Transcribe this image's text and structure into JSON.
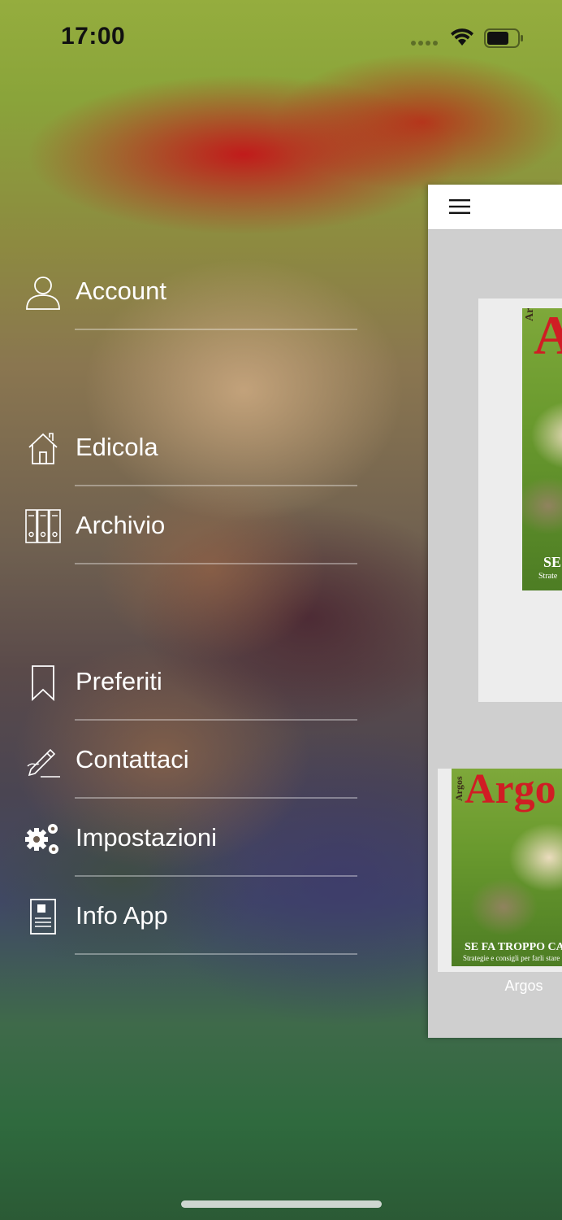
{
  "status_bar": {
    "time": "17:00",
    "icons": [
      "cellular-signal-icon",
      "wifi-icon",
      "battery-icon"
    ]
  },
  "menu": {
    "items": [
      {
        "label": "Account",
        "icon": "user-icon"
      },
      {
        "label": "Edicola",
        "icon": "home-icon"
      },
      {
        "label": "Archivio",
        "icon": "archive-binders-icon"
      },
      {
        "label": "Preferiti",
        "icon": "bookmark-icon"
      },
      {
        "label": "Contattaci",
        "icon": "signature-pen-icon"
      },
      {
        "label": "Impostazioni",
        "icon": "gears-icon"
      },
      {
        "label": "Info App",
        "icon": "document-info-icon"
      }
    ]
  },
  "content_panel": {
    "nav_icon": "hamburger-menu-icon",
    "featured_cover": {
      "brand": "Argos",
      "masthead": "A",
      "headline": "SE",
      "subline": "Strate"
    },
    "thumbnail": {
      "brand": "Argos",
      "masthead": "Argo",
      "headline": "SE FA TROPPO CA",
      "subline": "Strategie e consigli per farli stare"
    },
    "thumbnail_caption": "Argos"
  },
  "colors": {
    "menu_text": "#ffffff",
    "masthead_red": "#d01d24",
    "panel_background": "#cfcfcf",
    "nav_background": "#ffffff"
  }
}
